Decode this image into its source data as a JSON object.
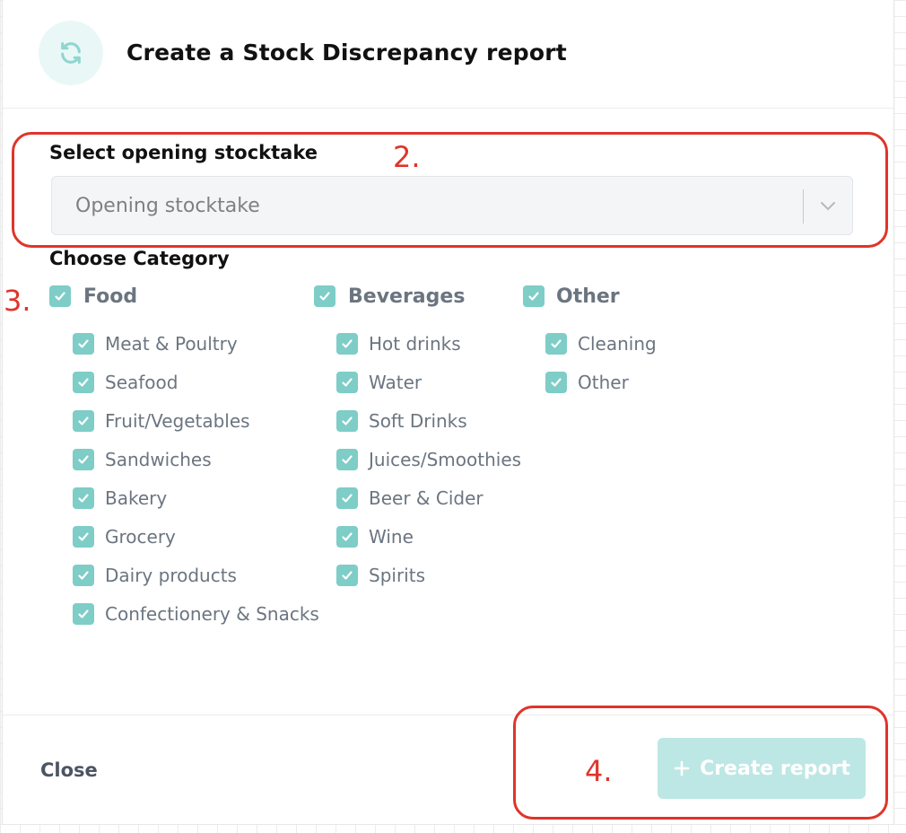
{
  "dialog": {
    "title": "Create a Stock Discrepancy report",
    "header_icon": "refresh-icon"
  },
  "opening_stocktake": {
    "label": "Select opening stocktake",
    "placeholder": "Opening stocktake"
  },
  "categories": {
    "label": "Choose Category",
    "groups": [
      {
        "name": "Food",
        "checked": true,
        "items": [
          {
            "label": "Meat & Poultry",
            "checked": true
          },
          {
            "label": "Seafood",
            "checked": true
          },
          {
            "label": "Fruit/Vegetables",
            "checked": true
          },
          {
            "label": "Sandwiches",
            "checked": true
          },
          {
            "label": "Bakery",
            "checked": true
          },
          {
            "label": "Grocery",
            "checked": true
          },
          {
            "label": "Dairy products",
            "checked": true
          },
          {
            "label": "Confectionery & Snacks",
            "checked": true
          }
        ]
      },
      {
        "name": "Beverages",
        "checked": true,
        "items": [
          {
            "label": "Hot drinks",
            "checked": true
          },
          {
            "label": "Water",
            "checked": true
          },
          {
            "label": "Soft Drinks",
            "checked": true
          },
          {
            "label": "Juices/Smoothies",
            "checked": true
          },
          {
            "label": "Beer & Cider",
            "checked": true
          },
          {
            "label": "Wine",
            "checked": true
          },
          {
            "label": "Spirits",
            "checked": true
          }
        ]
      },
      {
        "name": "Other",
        "checked": true,
        "items": [
          {
            "label": "Cleaning",
            "checked": true
          },
          {
            "label": "Other",
            "checked": true
          }
        ]
      }
    ]
  },
  "footer": {
    "close_label": "Close",
    "create_label": "Create report",
    "create_icon": "plus-icon"
  },
  "annotations": {
    "step2": "2.",
    "step3": "3.",
    "step4": "4."
  },
  "colors": {
    "accent": "#7ecdc7",
    "accent_light": "#e9f8f7",
    "button_disabled": "#bde7e4",
    "annotation": "#e0342a",
    "muted_text": "#6b7580"
  }
}
